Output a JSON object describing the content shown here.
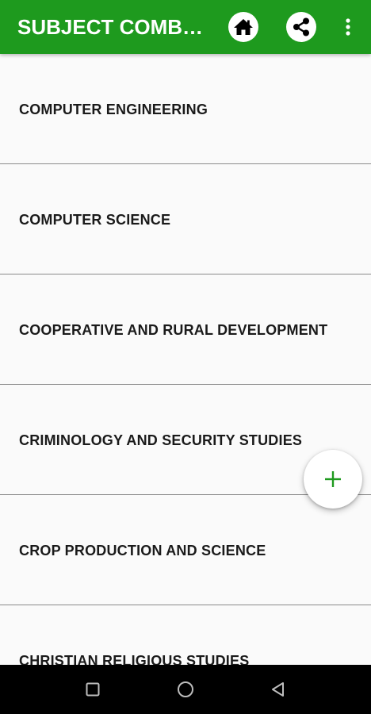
{
  "app_bar": {
    "title": "SUBJECT COMBIN...",
    "background_color": "#1e9a1e",
    "icons": [
      "home-icon",
      "share-icon",
      "more-vert-icon"
    ]
  },
  "list": {
    "items": [
      {
        "label": "COMPUTER ENGINEERING"
      },
      {
        "label": "COMPUTER SCIENCE"
      },
      {
        "label": "COOPERATIVE AND RURAL DEVELOPMENT"
      },
      {
        "label": "CRIMINOLOGY AND SECURITY STUDIES"
      },
      {
        "label": "CROP PRODUCTION AND SCIENCE"
      },
      {
        "label": "CHRISTIAN RELIGIOUS STUDIES"
      }
    ]
  },
  "fab": {
    "icon": "plus-icon",
    "icon_color": "#1e9a1e"
  },
  "nav_bar": {
    "icons": [
      "recents-icon",
      "nav-home-icon",
      "back-icon"
    ]
  }
}
